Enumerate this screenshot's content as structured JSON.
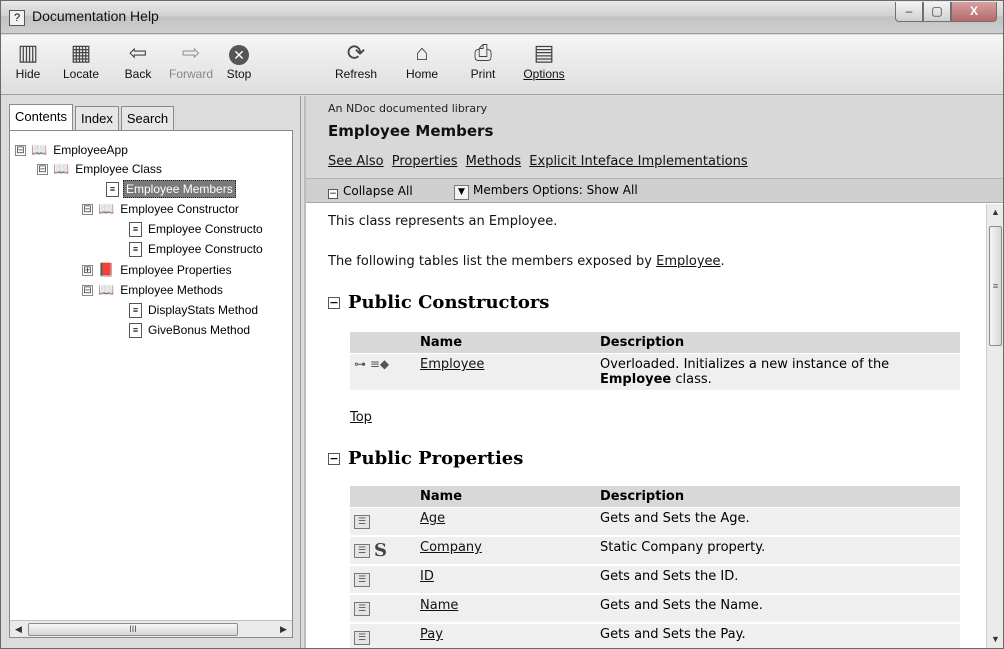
{
  "window": {
    "title": "Documentation Help",
    "minimize": "–",
    "maximize": "▢",
    "close": "X"
  },
  "toolbar": {
    "hide": "Hide",
    "locate": "Locate",
    "back": "Back",
    "forward": "Forward",
    "stop": "Stop",
    "refresh": "Refresh",
    "home": "Home",
    "print": "Print",
    "options": "Options"
  },
  "nav": {
    "tabs": [
      "Contents",
      "Index",
      "Search"
    ],
    "tree": [
      {
        "label": "EmployeeApp",
        "expander": "⊟",
        "icon": "open-book-icon"
      },
      {
        "label": "Employee Class",
        "expander": "⊟",
        "icon": "open-book-icon"
      },
      {
        "label": "Employee Members",
        "icon": "page-icon",
        "selected": true
      },
      {
        "label": "Employee Constructor",
        "expander": "⊟",
        "icon": "open-book-icon"
      },
      {
        "label": "Employee Constructo",
        "icon": "page-icon"
      },
      {
        "label": "Employee Constructo",
        "icon": "page-icon"
      },
      {
        "label": "Employee Properties",
        "expander": "⊞",
        "icon": "closed-book-icon"
      },
      {
        "label": "Employee Methods",
        "expander": "⊟",
        "icon": "open-book-icon"
      },
      {
        "label": "DisplayStats Method",
        "icon": "page-icon"
      },
      {
        "label": "GiveBonus Method",
        "icon": "page-icon"
      }
    ],
    "scroll_grip": "III"
  },
  "doc": {
    "banner_subtitle": "An NDoc documented library",
    "banner_title": "Employee Members",
    "links": [
      "See Also",
      "Properties",
      "Methods",
      "Explicit Inteface Implementations"
    ],
    "collapse_all": "Collapse All",
    "members_options": "Members Options: Show All",
    "intro": "This class represents an Employee.",
    "members_text": "The following tables list the members exposed by",
    "members_link": "Employee",
    "members_period": ".",
    "constructors": {
      "heading": "Public Constructors",
      "col_name": "Name",
      "col_desc": "Description",
      "rows": [
        {
          "name": "Employee",
          "desc_before": "Overloaded. Initializes a new instance of the",
          "desc_bold": "Employee",
          "desc_after": "class."
        }
      ],
      "top_link": "Top"
    },
    "properties": {
      "heading": "Public Properties",
      "col_name": "Name",
      "col_desc": "Description",
      "rows": [
        {
          "name": "Age",
          "desc": "Gets and Sets the Age.",
          "static": ""
        },
        {
          "name": "Company",
          "desc": "Static Company property.",
          "static": "S"
        },
        {
          "name": "ID",
          "desc": "Gets and Sets the ID.",
          "static": ""
        },
        {
          "name": "Name",
          "desc": "Gets and Sets the Name.",
          "static": ""
        },
        {
          "name": "Pay",
          "desc": "Gets and Sets the Pay.",
          "static": ""
        }
      ]
    }
  }
}
